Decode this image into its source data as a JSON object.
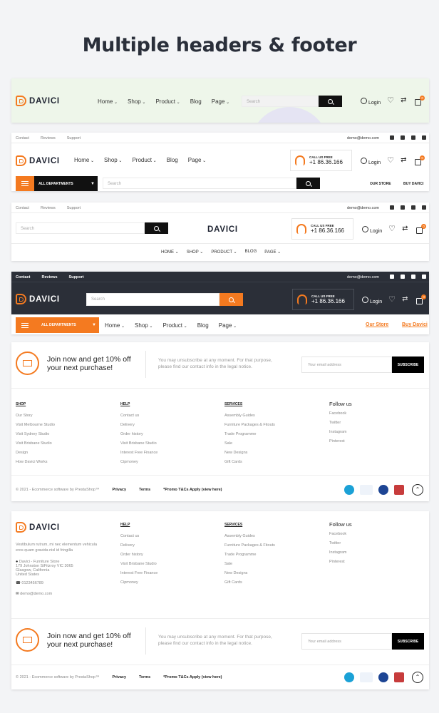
{
  "title": "Multiple headers & footer",
  "brand": "DAVICI",
  "nav": [
    "Home",
    "Shop",
    "Product",
    "Blog",
    "Page"
  ],
  "nav_upper": [
    "HOME",
    "SHOP",
    "PRODUCT",
    "BLOG",
    "PAGE"
  ],
  "search_placeholder": "Search",
  "login": "Login",
  "cart_count": "0",
  "topbar": {
    "contact": "Contact",
    "reviews": "Reviews",
    "support": "Support",
    "email": "demo@demo.com"
  },
  "call": {
    "label": "CALL US FREE",
    "phone": "+1 86.36.166"
  },
  "departments": "ALL DEPARTMENTS",
  "our_store": "OUR STORE",
  "buy_davici": "BUY DAVICI",
  "our_store_2": "Our Store",
  "buy_davici_2": "Buy Davici",
  "newsletter": {
    "heading_1": "Join now and get 10% off",
    "heading_2": "your next purchase!",
    "text_1": "You may unsubscribe at any moment. For that purpose,",
    "text_2": "please find our contact info in the legal notice.",
    "placeholder": "Your email address",
    "button": "SUBSCRIBE"
  },
  "footer": {
    "shop": {
      "title": "SHOP",
      "items": [
        "Our Story",
        "Visit Melbourne Studio",
        "Visit Sydney Studio",
        "Visit Brisbane Studio",
        "Design",
        "How Davici Works"
      ]
    },
    "help": {
      "title": "HELP",
      "items": [
        "Contact us",
        "Delivery",
        "Order history",
        "Visit Brisbane Studio",
        "Interest Free Finance",
        "Cipmoney"
      ]
    },
    "services": {
      "title": "SERVICES",
      "items": [
        "Assembly Guides",
        "Furniture Packages & Fitouts",
        "Trade Programme",
        "Sale",
        "New Designs",
        "Gift Cards"
      ]
    },
    "follow": {
      "title": "Follow us",
      "items": [
        "Facebook",
        "Twitter",
        "Instagram",
        "Pinterest"
      ]
    },
    "about": {
      "desc_1": "Vestibulum rutrum, mi nec elementum vehicula",
      "desc_2": "eros quam gravida nisl id fringilla",
      "store": "Davici - Furniture Store",
      "addr_1": "179 Johnston StFitzroy VIC 3065",
      "addr_2": "Glasgow, California",
      "addr_3": "United States",
      "phone": "0123456789",
      "email": "demo@demo.com"
    },
    "copyright": "© 2021 - Ecommerce software by PrestaShop™",
    "privacy": "Privacy",
    "terms": "Terms",
    "promo": "*Promo T&Cs Apply (view here)"
  },
  "colors": {
    "accent": "#f47a20",
    "dark": "#2b2f38"
  }
}
